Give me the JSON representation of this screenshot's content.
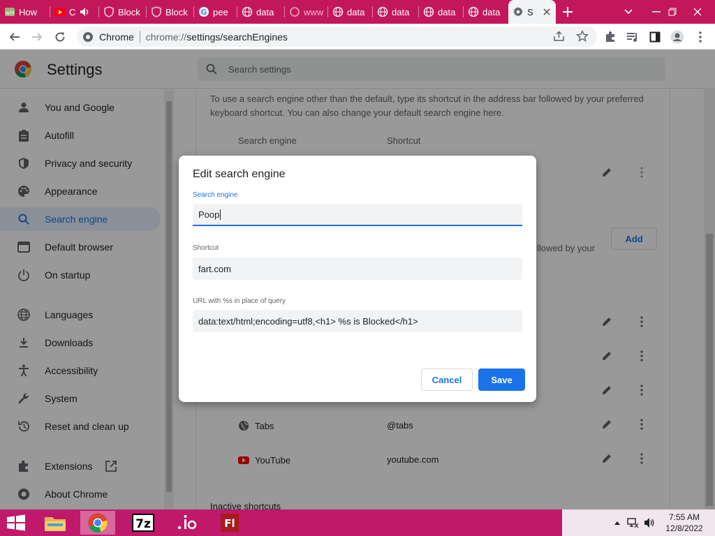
{
  "browser": {
    "tabs": [
      {
        "title": "How",
        "icon": "wikihow-icon"
      },
      {
        "title": "C",
        "icon": "youtube-icon",
        "audio": true
      },
      {
        "title": "Block",
        "icon": "shield-icon"
      },
      {
        "title": "Block",
        "icon": "shield-icon"
      },
      {
        "title": "pee",
        "icon": "google-icon"
      },
      {
        "title": "data",
        "icon": "globe-icon"
      },
      {
        "title": "www",
        "icon": "loading-icon"
      },
      {
        "title": "data",
        "icon": "globe-icon"
      },
      {
        "title": "data",
        "icon": "globe-icon"
      },
      {
        "title": "data",
        "icon": "globe-icon"
      },
      {
        "title": "data",
        "icon": "globe-icon"
      },
      {
        "title": "S",
        "icon": "gear-icon",
        "active": true
      }
    ],
    "omnibox": {
      "site_label": "Chrome",
      "scheme": "chrome://",
      "path": "settings/searchEngines"
    }
  },
  "settings": {
    "title": "Settings",
    "search_placeholder": "Search settings",
    "nav": [
      {
        "label": "You and Google",
        "icon": "person-icon"
      },
      {
        "label": "Autofill",
        "icon": "clipboard-icon"
      },
      {
        "label": "Privacy and security",
        "icon": "shield-icon"
      },
      {
        "label": "Appearance",
        "icon": "palette-icon"
      },
      {
        "label": "Search engine",
        "icon": "search-icon",
        "selected": true
      },
      {
        "label": "Default browser",
        "icon": "browser-icon"
      },
      {
        "label": "On startup",
        "icon": "power-icon"
      },
      {
        "label": "Languages",
        "icon": "globe-icon"
      },
      {
        "label": "Downloads",
        "icon": "download-icon"
      },
      {
        "label": "Accessibility",
        "icon": "accessibility-icon"
      },
      {
        "label": "System",
        "icon": "wrench-icon"
      },
      {
        "label": "Reset and clean up",
        "icon": "reset-icon"
      },
      {
        "label": "Extensions",
        "icon": "puzzle-icon",
        "external": true
      },
      {
        "label": "About Chrome",
        "icon": "chrome-icon"
      }
    ],
    "main": {
      "description": "To use a search engine other than the default, type its shortcut in the address bar followed by your preferred keyboard shortcut. You can also change your default search engine here.",
      "col_search_engine": "Search engine",
      "col_shortcut": "Shortcut",
      "add_label": "Add",
      "partial_text": "llowed by your",
      "rows": [
        {
          "name": "Tabs",
          "shortcut": "@tabs",
          "icon": "globe-icon"
        },
        {
          "name": "YouTube",
          "shortcut": "youtube.com",
          "icon": "youtube-icon"
        }
      ],
      "inactive_label": "Inactive shortcuts"
    }
  },
  "dialog": {
    "title": "Edit search engine",
    "search_engine_label": "Search engine",
    "search_engine_value": "Poop",
    "shortcut_label": "Shortcut",
    "shortcut_value": "fart.com",
    "url_label": "URL with %s in place of query",
    "url_value": "data:text/html;encoding=utf8,<h1> %s is Blocked</h1>",
    "cancel_label": "Cancel",
    "save_label": "Save"
  },
  "taskbar": {
    "apps": [
      "file-explorer-icon",
      "chrome-icon",
      "7zip-icon",
      "io-icon",
      "flash-icon"
    ],
    "time": "7:55 AM",
    "date": "12/8/2022"
  },
  "colors": {
    "accent": "#1a73e8",
    "tabstrip": "#c2185b",
    "taskbar": "#c0186b"
  }
}
